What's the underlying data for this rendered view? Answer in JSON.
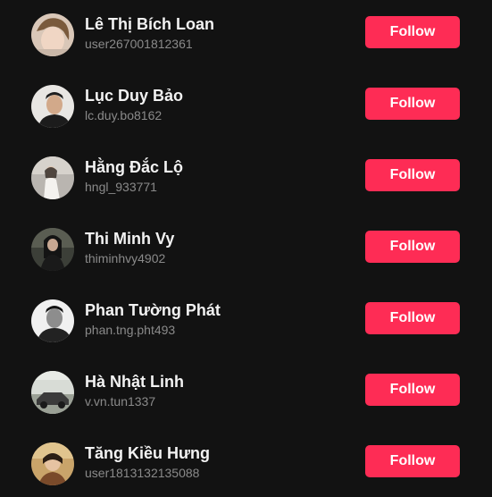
{
  "follow_label": "Follow",
  "accent_color": "#fe2c55",
  "users": [
    {
      "name": "Lê Thị Bích Loan",
      "handle": "user267001812361",
      "avatar": "profile-photo"
    },
    {
      "name": "Lục Duy Bảo",
      "handle": "lc.duy.bo8162",
      "avatar": "profile-photo"
    },
    {
      "name": "Hằng Đắc Lộ",
      "handle": "hngl_933771",
      "avatar": "profile-photo"
    },
    {
      "name": "Thi Minh Vy",
      "handle": "thiminhvy4902",
      "avatar": "profile-photo"
    },
    {
      "name": "Phan Tường Phát",
      "handle": "phan.tng.pht493",
      "avatar": "profile-photo"
    },
    {
      "name": "Hà Nhật Linh",
      "handle": "v.vn.tun1337",
      "avatar": "profile-photo"
    },
    {
      "name": "Tăng Kiều Hưng",
      "handle": "user1813132135088",
      "avatar": "profile-photo"
    }
  ]
}
